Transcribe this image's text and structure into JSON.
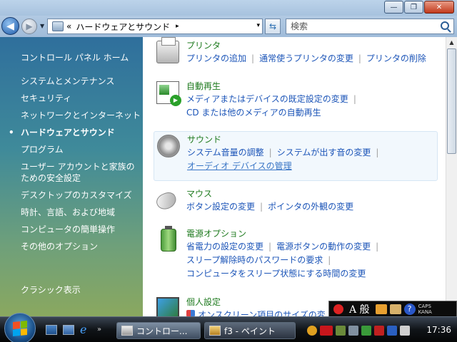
{
  "window": {
    "minimize_glyph": "—",
    "maximize_glyph": "❐",
    "close_glyph": "✕"
  },
  "address": {
    "chevrons": "«",
    "breadcrumb": "ハードウェアとサウンド",
    "crumb_arrow": "▸",
    "dropdown_glyph": "▾"
  },
  "search": {
    "placeholder": "検索"
  },
  "sidebar": {
    "home": "コントロール パネル ホーム",
    "items": [
      {
        "label": "システムとメンテナンス"
      },
      {
        "label": "セキュリティ"
      },
      {
        "label": "ネットワークとインターネット"
      },
      {
        "label": "ハードウェアとサウンド",
        "active": true
      },
      {
        "label": "プログラム"
      },
      {
        "label_line1": "ユーザー アカウントと家族の",
        "label_line2": "ための安全設定"
      },
      {
        "label": "デスクトップのカスタマイズ"
      },
      {
        "label": "時計、言語、および地域"
      },
      {
        "label": "コンピュータの簡単操作"
      },
      {
        "label": "その他のオプション"
      }
    ],
    "classic": "クラシック表示"
  },
  "categories": {
    "printer": {
      "title": "プリンタ",
      "links": [
        "プリンタの追加",
        "通常使うプリンタの変更",
        "プリンタの削除"
      ]
    },
    "autoplay": {
      "title": "自動再生",
      "links": [
        "メディアまたはデバイスの既定設定の変更",
        "CD または他のメディアの自動再生"
      ]
    },
    "sound": {
      "title": "サウンド",
      "links": [
        "システム音量の調整",
        "システムが出す音の変更",
        "オーディオ デバイスの管理"
      ]
    },
    "mouse": {
      "title": "マウス",
      "links": [
        "ボタン設定の変更",
        "ポインタの外観の変更"
      ]
    },
    "power": {
      "title": "電源オプション",
      "links": [
        "省電力の設定の変更",
        "電源ボタンの動作の変更",
        "スリープ解除時のパスワードの要求",
        "コンピュータをスリープ状態にする時間の変更"
      ]
    },
    "personalize": {
      "title": "個人設定",
      "links": [
        "オンスクリーン項目のサイズの変"
      ]
    }
  },
  "taskbar": {
    "tasks": [
      "コントロー...",
      "f3 - ペイント"
    ],
    "clock": "17:36",
    "quicklaunch_more": "»"
  },
  "ime": {
    "mode": "A 般",
    "help": "?",
    "caps": "CAPS",
    "kana": "KANA"
  },
  "colors": {
    "link": "#1c55b8",
    "category_title": "#1e7a1e",
    "sidebar_top": "#2f6f9c",
    "sidebar_bottom": "#8aa85f"
  }
}
